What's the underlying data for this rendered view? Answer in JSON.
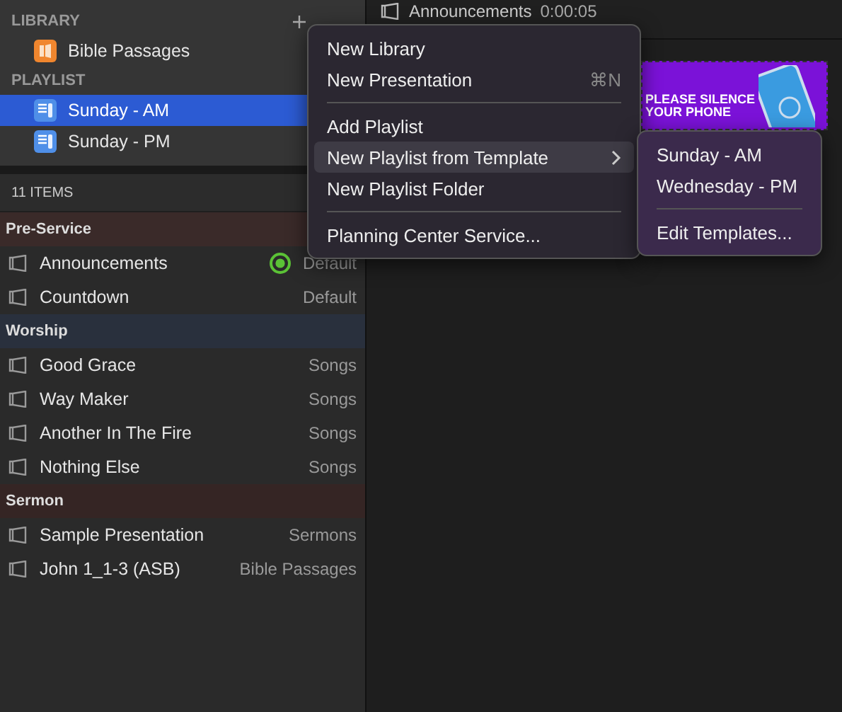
{
  "library": {
    "title": "LIBRARY",
    "items": [
      {
        "label": "Bible Passages"
      }
    ]
  },
  "playlist": {
    "title": "PLAYLIST",
    "items": [
      {
        "label": "Sunday - AM",
        "selected": true
      },
      {
        "label": "Sunday - PM",
        "selected": false
      }
    ]
  },
  "items_count": "11 ITEMS",
  "groups": [
    {
      "name": "Pre-Service",
      "color": "#3a2a29",
      "items": [
        {
          "title": "Announcements",
          "arrangement": "Default",
          "live": true
        },
        {
          "title": "Countdown",
          "arrangement": "Default",
          "live": false
        }
      ]
    },
    {
      "name": "Worship",
      "color": "#29303d",
      "items": [
        {
          "title": "Good Grace",
          "arrangement": "Songs",
          "live": false
        },
        {
          "title": "Way Maker",
          "arrangement": "Songs",
          "live": false
        },
        {
          "title": "Another In The Fire",
          "arrangement": "Songs",
          "live": false
        },
        {
          "title": "Nothing Else",
          "arrangement": "Songs",
          "live": false
        }
      ]
    },
    {
      "name": "Sermon",
      "color": "#352524",
      "items": [
        {
          "title": "Sample Presentation",
          "arrangement": "Sermons",
          "live": false
        },
        {
          "title": "John 1_1-3 (ASB)",
          "arrangement": "Bible Passages",
          "live": false
        }
      ]
    }
  ],
  "preview": {
    "title": "Announcements",
    "time": "0:00:05",
    "slide_text": [
      "PLEASE SILENCE",
      "YOUR PHONE"
    ]
  },
  "menu": {
    "items": [
      {
        "kind": "item",
        "label": "New Library",
        "selected": false
      },
      {
        "kind": "item",
        "label": "New Presentation",
        "shortcut": "⌘N",
        "selected": false
      },
      {
        "kind": "separator"
      },
      {
        "kind": "item",
        "label": "Add Playlist",
        "selected": false
      },
      {
        "kind": "item",
        "label": "New Playlist from Template",
        "submenu": true,
        "selected": true
      },
      {
        "kind": "item",
        "label": "New Playlist Folder",
        "selected": false
      },
      {
        "kind": "separator"
      },
      {
        "kind": "item",
        "label": "Planning Center Service...",
        "selected": false
      }
    ]
  },
  "submenu": {
    "items": [
      {
        "kind": "item",
        "label": "Sunday - AM"
      },
      {
        "kind": "item",
        "label": "Wednesday - PM"
      },
      {
        "kind": "separator"
      },
      {
        "kind": "item",
        "label": "Edit Templates..."
      }
    ]
  }
}
